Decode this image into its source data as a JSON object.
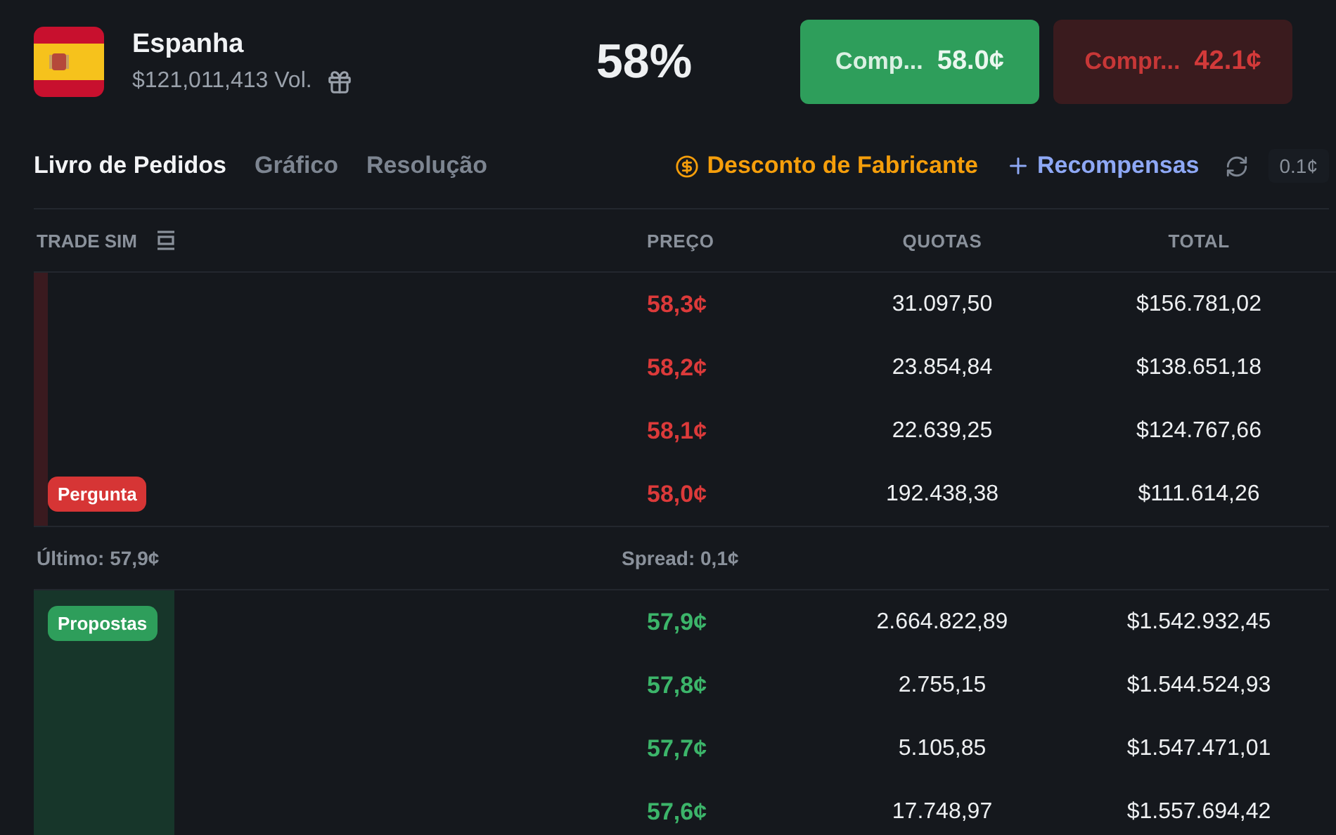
{
  "market": {
    "name": "Espanha",
    "volume": "$121,011,413 Vol.",
    "chance": "58%"
  },
  "buy_buttons": [
    {
      "kind": "yes",
      "label": "Comp...",
      "price": "58.0¢"
    },
    {
      "kind": "no",
      "label": "Compr...",
      "price": "42.1¢"
    }
  ],
  "tabs": [
    {
      "label": "Livro de Pedidos",
      "selected": true
    },
    {
      "label": "Gráfico",
      "selected": false
    },
    {
      "label": "Resolução",
      "selected": false
    }
  ],
  "actions": {
    "discount": "Desconto de Fabricante",
    "rewards": "Recompensas",
    "tick": "0.1¢"
  },
  "columns": [
    "TRADE SIM",
    "PREÇO",
    "QUOTAS",
    "TOTAL"
  ],
  "asks": {
    "label": "Pergunta",
    "rows": [
      {
        "price": "58,3¢",
        "shares": "31.097,50",
        "total": "$156.781,02"
      },
      {
        "price": "58,2¢",
        "shares": "23.854,84",
        "total": "$138.651,18"
      },
      {
        "price": "58,1¢",
        "shares": "22.639,25",
        "total": "$124.767,66"
      },
      {
        "price": "58,0¢",
        "shares": "192.438,38",
        "total": "$111.614,26"
      }
    ]
  },
  "spread": {
    "last": "Último: 57,9¢",
    "spread": "Spread: 0,1¢"
  },
  "bids": {
    "label": "Propostas",
    "rows": [
      {
        "price": "57,9¢",
        "shares": "2.664.822,89",
        "total": "$1.542.932,45"
      },
      {
        "price": "57,8¢",
        "shares": "2.755,15",
        "total": "$1.544.524,93"
      },
      {
        "price": "57,7¢",
        "shares": "5.105,85",
        "total": "$1.547.471,01"
      },
      {
        "price": "57,6¢",
        "shares": "17.748,97",
        "total": "$1.557.694,42"
      }
    ]
  }
}
